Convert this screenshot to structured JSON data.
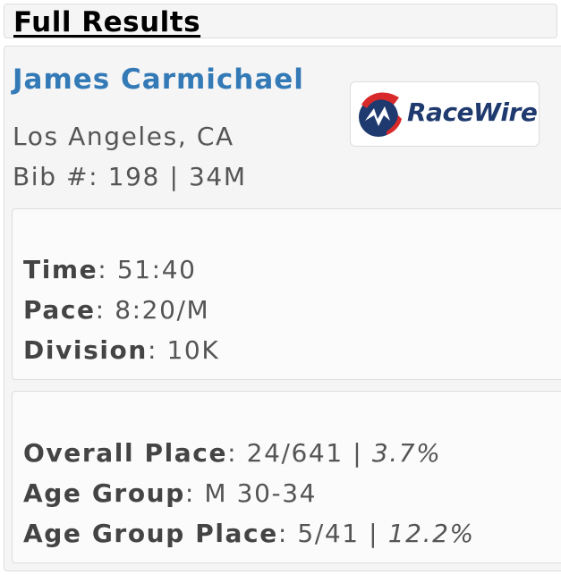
{
  "header": {
    "title": "Full Results"
  },
  "athlete": {
    "name": "James Carmichael",
    "location": "Los Angeles, CA",
    "bib_label": "Bib #:",
    "bib_number": "198",
    "separator": "|",
    "age_gender": "34M"
  },
  "logo": {
    "text": "RaceWire",
    "icon": "racewire-logo-icon",
    "colors": {
      "blue": "#1f3a6e",
      "red": "#d82a2a"
    }
  },
  "timing": {
    "time_label": "Time",
    "time_value": "51:40",
    "pace_label": "Pace",
    "pace_value": "8:20/M",
    "division_label": "Division",
    "division_value": "10K"
  },
  "placing": {
    "overall_label": "Overall Place",
    "overall_value": "24/641",
    "overall_pct": "3.7%",
    "age_group_label": "Age Group",
    "age_group_value": "M 30-34",
    "age_group_place_label": "Age Group Place",
    "age_group_place_value": "5/41",
    "age_group_place_pct": "12.2%",
    "separator": "|",
    "colon": ":"
  },
  "colors": {
    "name_link": "#337ab7",
    "panel_bg": "#f5f5f5",
    "card_bg": "#fbfbfb",
    "border": "#dddddd",
    "text": "#555555"
  }
}
